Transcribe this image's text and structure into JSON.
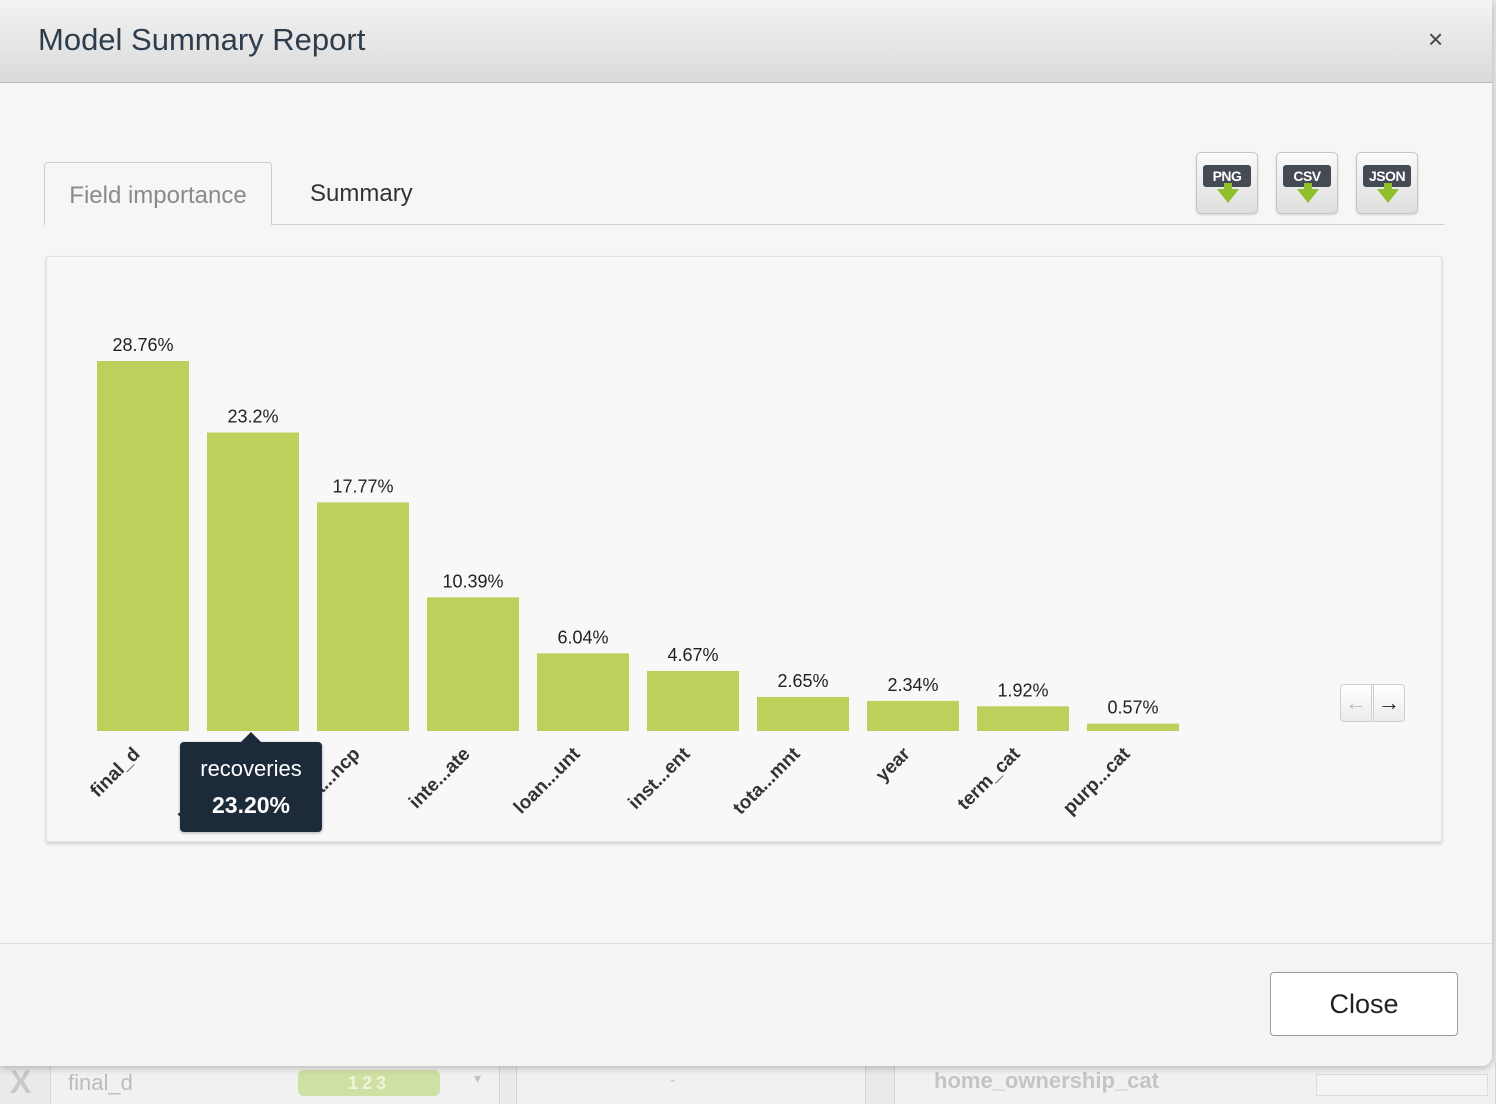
{
  "modal": {
    "title": "Model Summary Report",
    "close_icon": "×",
    "close_button": "Close"
  },
  "tabs": [
    {
      "label": "Field importance",
      "active": true
    },
    {
      "label": "Summary",
      "active": false
    }
  ],
  "downloads": [
    {
      "label": "PNG",
      "icon": "png-download-icon"
    },
    {
      "label": "CSV",
      "icon": "csv-download-icon"
    },
    {
      "label": "JSON",
      "icon": "json-download-icon"
    }
  ],
  "pager": {
    "prev": "←",
    "next": "→"
  },
  "tooltip": {
    "name": "recoveries",
    "value": "23.20%"
  },
  "colors": {
    "bar": "#bdd05b",
    "tooltip_bg": "#1c2a3a",
    "title": "#2d3d4b"
  },
  "chart_data": {
    "type": "bar",
    "categories": [
      "final_d",
      "recoveries",
      "tota...ncp",
      "inte...ate",
      "loan...unt",
      "inst...ent",
      "tota...mnt",
      "year",
      "term_cat",
      "purp...cat"
    ],
    "values": [
      28.76,
      23.2,
      17.77,
      10.39,
      6.04,
      4.67,
      2.65,
      2.34,
      1.92,
      0.57
    ],
    "value_labels": [
      "28.76%",
      "23.2%",
      "17.77%",
      "10.39%",
      "6.04%",
      "4.67%",
      "2.65%",
      "2.34%",
      "1.92%",
      "0.57%"
    ],
    "title": "",
    "xlabel": "",
    "ylabel": "",
    "grid": false
  },
  "background": {
    "x_label": "X",
    "field": "final_d",
    "badge": "123",
    "dropdown": "▾",
    "dash": "-",
    "column": "home_ownership_cat"
  }
}
